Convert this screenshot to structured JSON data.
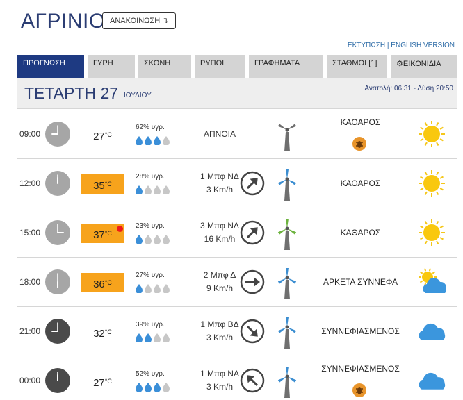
{
  "header": {
    "city": "ΑΓΡΙΝΙΟ",
    "announce_label": "ΑΝΑΚΟΙΝΩΣΗ ↴",
    "print_link": "ΕΚΤΥΠΩΣΗ",
    "separator": " | ",
    "english_link": "ENGLISH VERSION"
  },
  "tabs": [
    "ΠΡΟΓΝΩΣΗ",
    "ΓΥΡΗ",
    "ΣΚΟΝΗ",
    "ΡΥΠΟΙ",
    "ΓΡΑΦΗΜΑΤΑ",
    "ΣΤΑΘΜΟΙ [1]",
    "⚙ΕΙΚΟΝΙΔΙΑ"
  ],
  "active_tab": "ΠΡΟΓΝΩΣΗ",
  "date": {
    "day": "ΤΕΤΑΡΤΗ 27",
    "month": "ΙΟΥΛΙΟΥ",
    "sun_times": "Ανατολή: 06:31  - Δύση 20:50"
  },
  "temp_unit": "°C",
  "colors": {
    "brand": "#1e3a82",
    "hot": "#f7a31c",
    "tab": "#d4d4d4",
    "drop_on": "#3b8fd8",
    "drop_off": "#c7c7c7"
  },
  "forecast": [
    {
      "time": "09:00",
      "night": false,
      "temp": "27",
      "hot": false,
      "alert": false,
      "humidity": "62% υγρ.",
      "drops": 3,
      "wind_bft": "ΑΠΝΟΙΑ",
      "wind_kmh": "",
      "wind_icon": "none",
      "turbine": "grey",
      "condition": "ΚΑΘΑΡΟΣ",
      "dust": true,
      "weather_icon": "sun-icon"
    },
    {
      "time": "12:00",
      "night": false,
      "temp": "35",
      "hot": true,
      "alert": false,
      "humidity": "28% υγρ.",
      "drops": 1,
      "wind_bft": "1 Μπφ ΝΔ",
      "wind_kmh": "3 Km/h",
      "wind_icon": "arrow-ne",
      "turbine": "blue",
      "condition": "ΚΑΘΑΡΟΣ",
      "dust": false,
      "weather_icon": "sun-icon"
    },
    {
      "time": "15:00",
      "night": false,
      "temp": "37",
      "hot": true,
      "alert": true,
      "humidity": "23% υγρ.",
      "drops": 1,
      "wind_bft": "3 Μπφ ΝΔ",
      "wind_kmh": "16 Km/h",
      "wind_icon": "arrow-ne",
      "turbine": "green",
      "condition": "ΚΑΘΑΡΟΣ",
      "dust": false,
      "weather_icon": "sun-icon"
    },
    {
      "time": "18:00",
      "night": false,
      "temp": "36",
      "hot": true,
      "alert": false,
      "humidity": "27% υγρ.",
      "drops": 1,
      "wind_bft": "2 Μπφ Δ",
      "wind_kmh": "9 Km/h",
      "wind_icon": "arrow-e",
      "turbine": "blue",
      "condition": "ΑΡΚΕΤΑ ΣΥΝΝΕΦΑ",
      "dust": false,
      "weather_icon": "sun-cloud-icon"
    },
    {
      "time": "21:00",
      "night": true,
      "temp": "32",
      "hot": false,
      "alert": false,
      "humidity": "39% υγρ.",
      "drops": 2,
      "wind_bft": "1 Μπφ ΒΔ",
      "wind_kmh": "3 Km/h",
      "wind_icon": "arrow-se",
      "turbine": "blue",
      "condition": "ΣΥΝΝΕΦΙΑΣΜΕΝΟΣ",
      "dust": false,
      "weather_icon": "cloud-icon"
    },
    {
      "time": "00:00",
      "night": true,
      "temp": "27",
      "hot": false,
      "alert": false,
      "humidity": "52% υγρ.",
      "drops": 3,
      "wind_bft": "1 Μπφ ΝΑ",
      "wind_kmh": "3 Km/h",
      "wind_icon": "arrow-nw",
      "turbine": "blue",
      "condition": "ΣΥΝΝΕΦΙΑΣΜΕΝΟΣ",
      "dust": true,
      "weather_icon": "cloud-icon"
    }
  ]
}
